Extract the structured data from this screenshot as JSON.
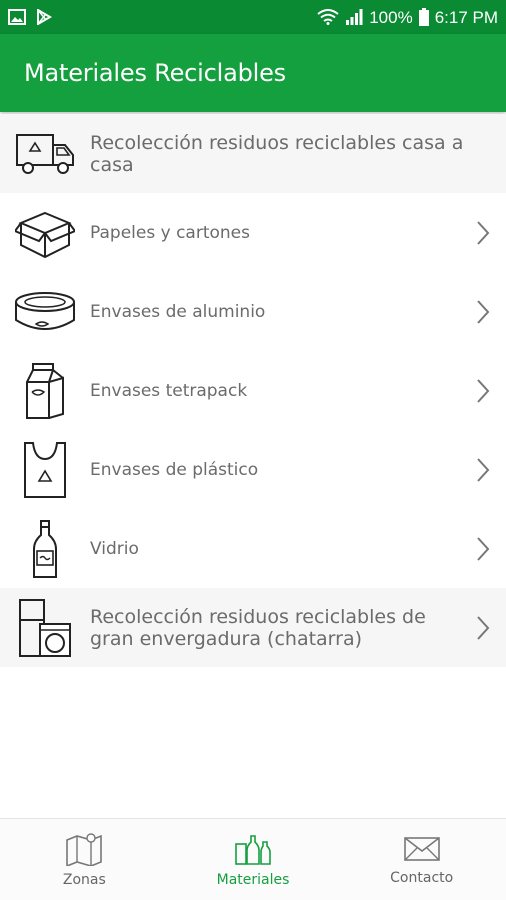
{
  "status_bar": {
    "battery": "100%",
    "time": "6:17 PM",
    "icons": [
      "image-icon",
      "play-store-icon",
      "wifi-icon",
      "signal-icon",
      "battery-icon"
    ]
  },
  "app_bar": {
    "title": "Materiales Reciclables"
  },
  "items": [
    {
      "label": "Recolección residuos reciclables casa a casa",
      "icon": "truck-icon"
    },
    {
      "label": "Papeles y cartones",
      "icon": "box-icon"
    },
    {
      "label": "Envases de aluminio",
      "icon": "can-icon"
    },
    {
      "label": "Envases tetrapack",
      "icon": "carton-icon"
    },
    {
      "label": "Envases de plástico",
      "icon": "plastic-bag-icon"
    },
    {
      "label": "Vidrio",
      "icon": "bottle-icon"
    },
    {
      "label": "Recolección residuos reciclables de gran envergadura (chatarra)",
      "icon": "appliances-icon"
    }
  ],
  "bottom_nav": {
    "zonas": "Zonas",
    "materiales": "Materiales",
    "contacto": "Contacto",
    "active": "Materiales"
  },
  "colors": {
    "primary": "#15a03f",
    "status_bar": "#0a8a32",
    "text": "#6b6b6b"
  }
}
